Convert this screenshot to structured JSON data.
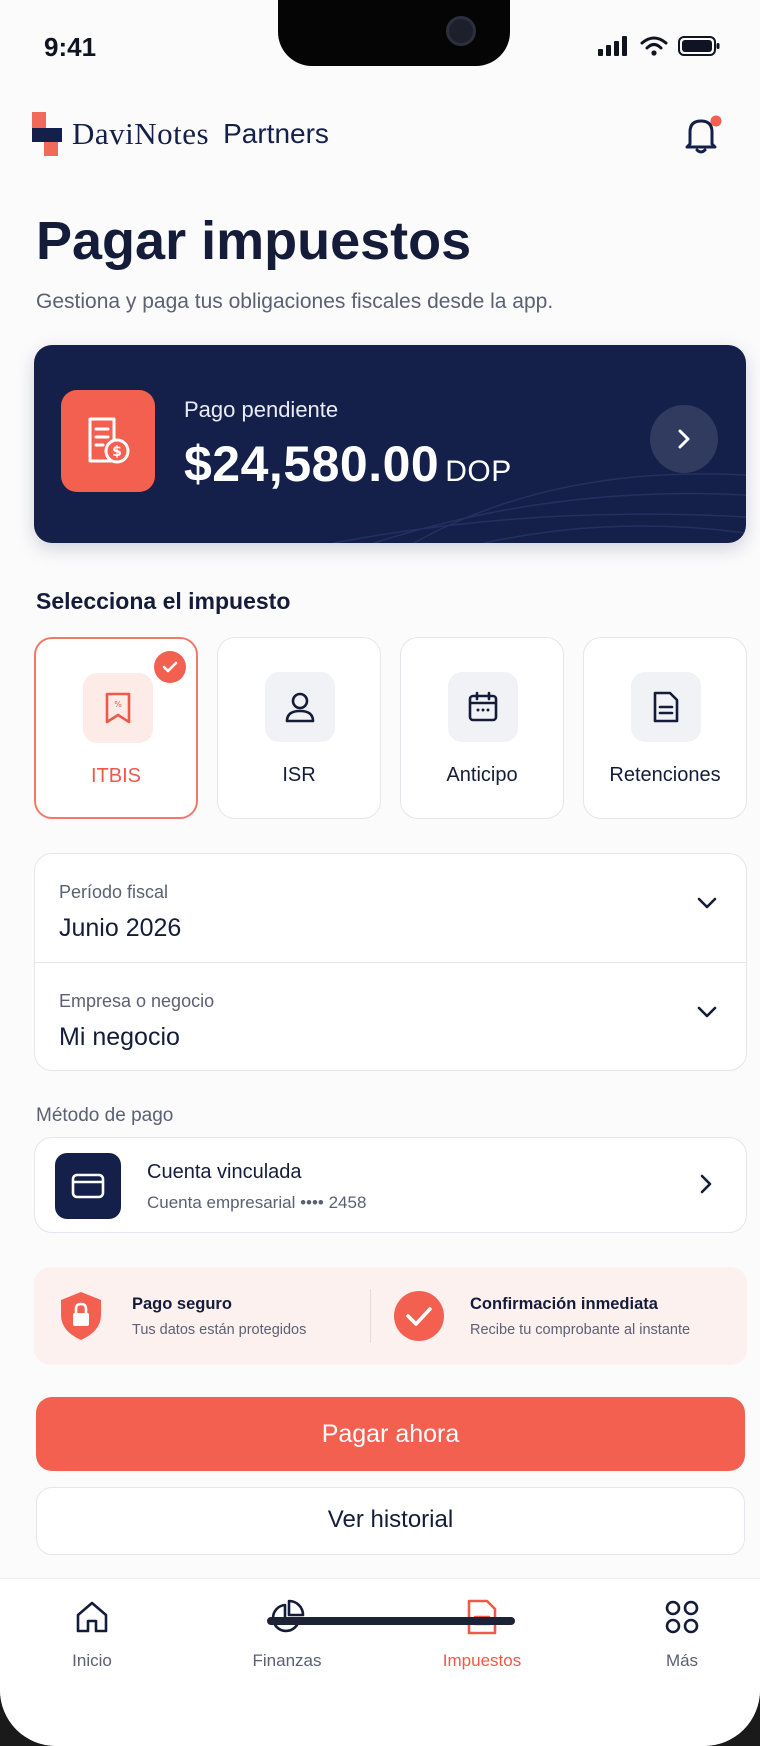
{
  "status_bar": {
    "time": "9:41"
  },
  "header": {
    "logo_text": "DaviNotes",
    "logo_suffix": "Partners"
  },
  "page": {
    "title": "Pagar impuestos",
    "subtitle": "Gestiona y paga tus obligaciones fiscales desde la app."
  },
  "pending": {
    "label": "Pago pendiente",
    "amount": "$24,580.00",
    "currency": "DOP"
  },
  "tax_section": {
    "label": "Selecciona el impuesto",
    "options": [
      {
        "label": "ITBIS",
        "icon": "receipt-icon",
        "selected": true
      },
      {
        "label": "ISR",
        "icon": "user-icon",
        "selected": false
      },
      {
        "label": "Anticipo",
        "icon": "calendar-icon",
        "selected": false
      },
      {
        "label": "Retenciones",
        "icon": "document-icon",
        "selected": false
      }
    ]
  },
  "fiscal_period": {
    "caption": "Período fiscal",
    "value": "Junio 2026"
  },
  "business": {
    "caption": "Empresa o negocio",
    "value": "Mi negocio"
  },
  "payment_method": {
    "label": "Método de pago",
    "title": "Cuenta vinculada",
    "subtitle": "Cuenta empresarial •••• 2458"
  },
  "security": {
    "items": [
      {
        "title": "Pago seguro",
        "subtitle": "Tus datos están protegidos"
      },
      {
        "title": "Confirmación inmediata",
        "subtitle": "Recibe tu comprobante al instante"
      }
    ]
  },
  "actions": {
    "pay": "Pagar ahora",
    "history": "Ver historial"
  },
  "nav": {
    "items": [
      {
        "label": "Inicio",
        "active": false
      },
      {
        "label": "Finanzas",
        "active": false
      },
      {
        "label": "Impuestos",
        "active": true
      },
      {
        "label": "Más",
        "active": false
      }
    ]
  },
  "colors": {
    "accent": "#f4604f",
    "navy": "#15204a"
  }
}
